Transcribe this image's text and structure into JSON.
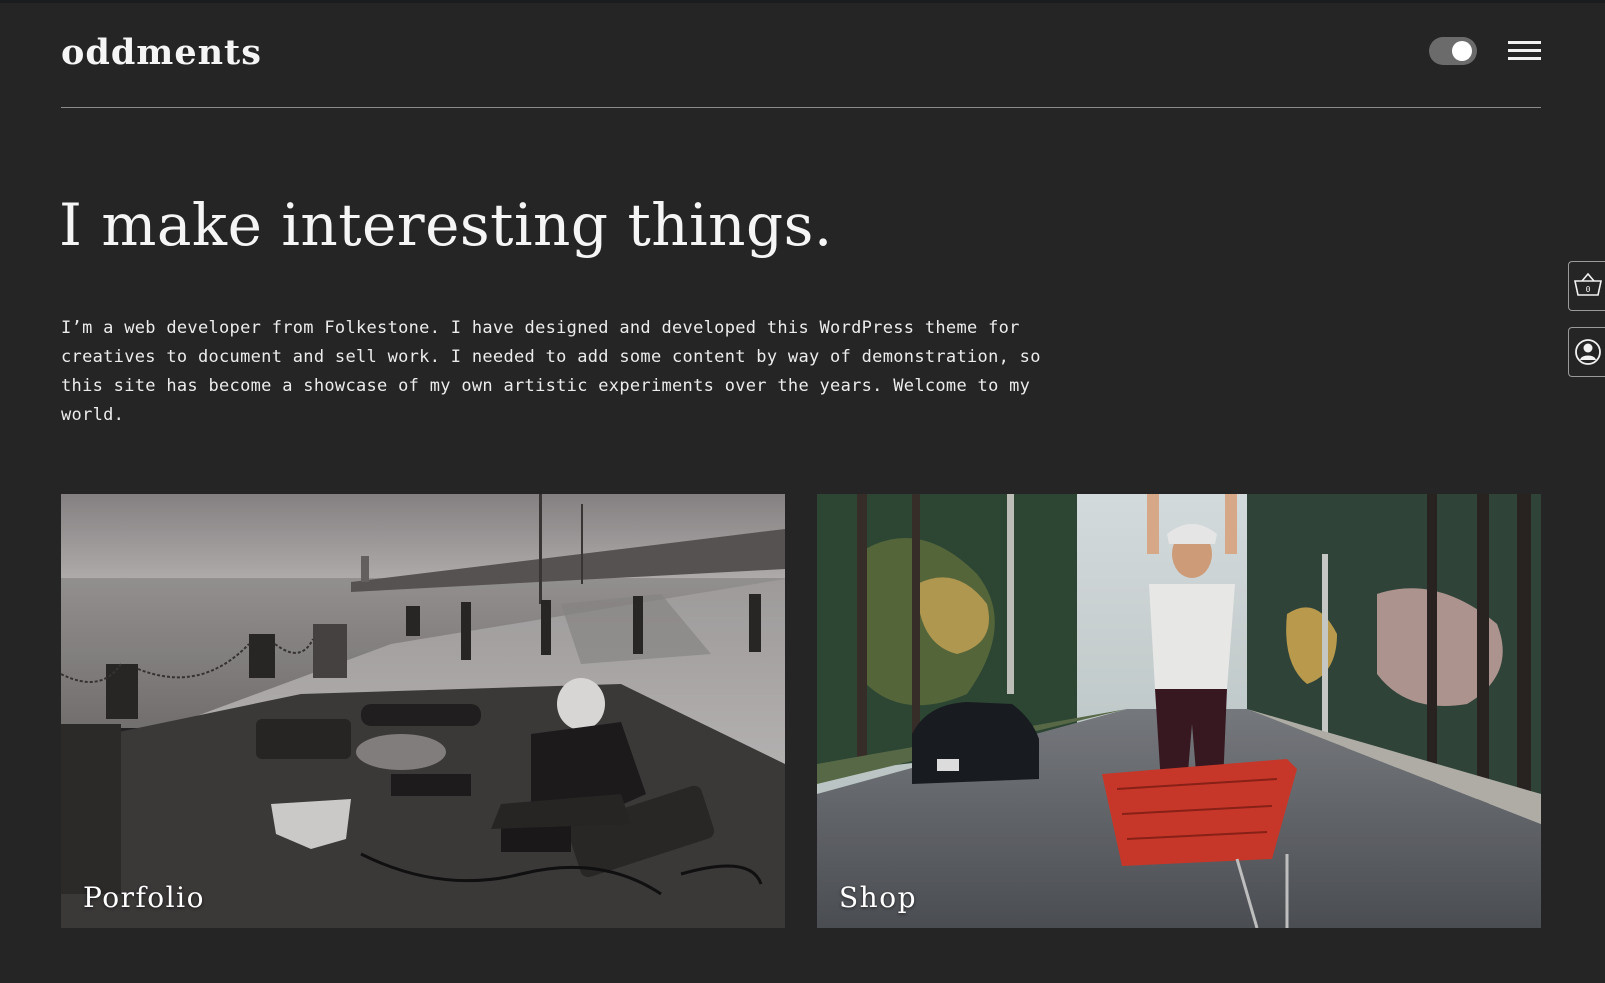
{
  "header": {
    "site_title": "oddments",
    "theme_toggle_icon": "toggle-switch-icon",
    "menu_icon": "hamburger-menu-icon"
  },
  "hero": {
    "headline": "I make interesting things.",
    "intro": "I’m a web developer from Folkestone. I have designed and developed this WordPress theme for creatives to document and sell work. I needed to add some content by way of demonstration, so this site has become a showcase of my own artistic experiments over the years. Welcome to my world."
  },
  "side_tabs": {
    "cart_count": "0",
    "cart_icon": "basket-icon",
    "account_icon": "user-account-icon"
  },
  "cards": [
    {
      "label": "Porfolio",
      "image": "black-and-white photo of musician with equipment on a pier"
    },
    {
      "label": "Shop",
      "image": "man standing on red shopping cart on palm-lined street"
    }
  ],
  "colors": {
    "background": "#252526",
    "text": "#f2f2f2",
    "divider": "#8a8a8a",
    "toggle_track": "#6b6b6b",
    "cart_red": "#d23a2c"
  }
}
